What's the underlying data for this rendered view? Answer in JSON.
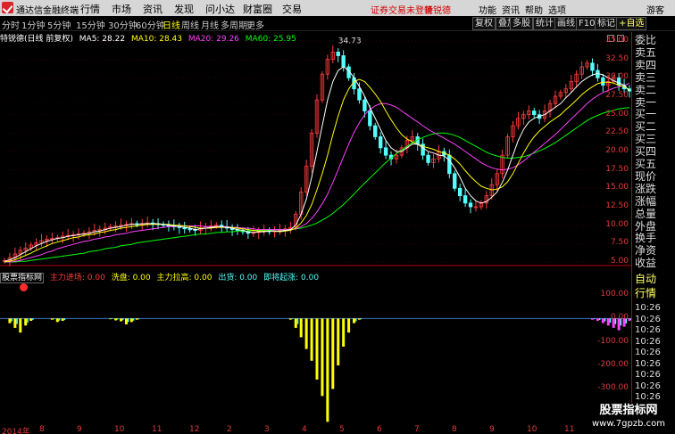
{
  "app_title": "通达信金融终端",
  "menu": [
    "行情",
    "市场",
    "资讯",
    "发现",
    "问小达",
    "财富圈",
    "交易"
  ],
  "status_warning": "证券交易未登录",
  "status_stock": "特锐德",
  "right_menu": [
    "功能",
    "资讯",
    "帮助",
    "选项",
    "游客"
  ],
  "periods": [
    {
      "label": "分时",
      "active": false
    },
    {
      "label": "1分钟",
      "active": false
    },
    {
      "label": "5分钟",
      "active": false
    },
    {
      "label": "15分钟",
      "active": false
    },
    {
      "label": "30分钟",
      "active": false
    },
    {
      "label": "60分钟",
      "active": false
    },
    {
      "label": "日线",
      "active": true
    },
    {
      "label": "周线",
      "active": false
    },
    {
      "label": "月线",
      "active": false
    },
    {
      "label": "多周期",
      "active": false
    },
    {
      "label": "更多",
      "active": false
    }
  ],
  "toolbar": [
    "复权",
    "叠加",
    "多股",
    "统计",
    "画线",
    "F10",
    "标记",
    "+自选"
  ],
  "legend": {
    "title": "特锐德(日线 前复权)",
    "ma5": "MA5: 28.22",
    "ma10": "MA10: 28.43",
    "ma20": "MA20: 29.26",
    "ma60": "MA60: 25.95"
  },
  "colors": {
    "ma5": "#ffffff",
    "ma10": "#ffff00",
    "ma20": "#ff40ff",
    "ma60": "#00ff00",
    "up": "#ff3c3c",
    "down": "#54ffff",
    "axis": "#dd3b3b",
    "warn": "#d40000"
  },
  "peak_label": "34.73",
  "indicator": {
    "name": "股票指标网",
    "main_entry": "主力进场: 0.00",
    "wash": "洗盘: 0.00",
    "pullup": "主力拉高: 0.00",
    "exit": "出货: 0.00",
    "surge": "即将起涨: 0.00"
  },
  "price_axis": [
    "35.00",
    "32.50",
    "30.00",
    "27.50",
    "25.00",
    "22.50",
    "20.00",
    "17.50",
    "15.00",
    "12.50",
    "10.00",
    "7.50",
    "5.00"
  ],
  "ind_axis": [
    "100.00",
    "0.00",
    "-100.00",
    "-200.00",
    "-300.00",
    "-400.00"
  ],
  "x_axis": [
    "2014年",
    "8",
    "9",
    "10",
    "11",
    "12",
    "2",
    "3",
    "4",
    "5",
    "6",
    "7",
    "8",
    "9",
    "10",
    "11"
  ],
  "side": {
    "items": [
      "委比",
      "卖五",
      "卖四",
      "卖三",
      "卖二",
      "卖一",
      "买一",
      "买二",
      "买三",
      "买四",
      "买五",
      "现价",
      "涨跌",
      "涨幅",
      "总量",
      "外盘",
      "换手",
      "净资",
      "收益"
    ],
    "auto": "自动",
    "quote": "行情",
    "times": [
      "10:26",
      "10:26",
      "10:26",
      "10:26",
      "10:26",
      "10:26",
      "10:26",
      "10:26",
      "10:26",
      "10:26",
      "10:26",
      "10:26"
    ],
    "unit": "500"
  },
  "watermark": {
    "line1": "股票指标网",
    "line2": "www.7gpzb.com"
  },
  "chart_data": {
    "type": "candlestick",
    "ylim": [
      5,
      35
    ],
    "ind_ylim": [
      -450,
      100
    ],
    "close": [
      5.2,
      5.6,
      6.1,
      6.6,
      6.9,
      7.3,
      7.6,
      7.9,
      8.1,
      8.2,
      8.3,
      8.5,
      8.6,
      8.7,
      8.8,
      8.9,
      9.1,
      9.3,
      9.4,
      9.6,
      9.8,
      9.9,
      10.0,
      10.1,
      10.2,
      10.1,
      10.2,
      10.3,
      10.2,
      10.1,
      10.0,
      9.9,
      9.8,
      9.7,
      9.5,
      9.4,
      9.3,
      9.6,
      9.8,
      9.9,
      10.0,
      9.8,
      9.6,
      9.4,
      9.3,
      9.1,
      8.9,
      9.0,
      9.2,
      9.3,
      9.1,
      9.2,
      9.3,
      9.5,
      9.7,
      11.5,
      14.5,
      18.0,
      22.5,
      27.0,
      30.5,
      32.5,
      33.5,
      33.0,
      31.5,
      30.0,
      28.5,
      27.0,
      25.5,
      23.5,
      22.0,
      20.5,
      19.5,
      19.0,
      19.5,
      20.5,
      21.5,
      22.0,
      21.0,
      19.5,
      18.5,
      19.0,
      20.0,
      19.5,
      17.0,
      15.0,
      14.0,
      13.0,
      12.5,
      12.5,
      13.0,
      14.0,
      15.5,
      17.0,
      19.5,
      22.0,
      23.5,
      24.5,
      25.0,
      25.5,
      25.0,
      24.5,
      25.5,
      26.5,
      27.5,
      28.0,
      28.5,
      29.5,
      30.5,
      31.5,
      32.0,
      31.0,
      30.0,
      29.0,
      29.5,
      30.0,
      29.0,
      28.5,
      28.2
    ],
    "ma5": [
      5.1,
      5.3,
      5.6,
      6.0,
      6.4,
      6.8,
      7.2,
      7.5,
      7.8,
      8.0,
      8.2,
      8.3,
      8.5,
      8.6,
      8.7,
      8.8,
      8.9,
      9.1,
      9.2,
      9.4,
      9.6,
      9.7,
      9.8,
      10.0,
      10.1,
      10.1,
      10.2,
      10.2,
      10.2,
      10.2,
      10.1,
      10.0,
      9.9,
      9.8,
      9.7,
      9.6,
      9.4,
      9.5,
      9.6,
      9.7,
      9.8,
      9.8,
      9.7,
      9.6,
      9.4,
      9.3,
      9.1,
      9.0,
      9.1,
      9.1,
      9.2,
      9.2,
      9.2,
      9.3,
      9.4,
      10.0,
      11.5,
      13.5,
      16.5,
      20.0,
      23.5,
      27.0,
      29.5,
      31.0,
      31.5,
      31.0,
      30.0,
      28.8,
      27.5,
      26.0,
      24.5,
      23.0,
      21.5,
      20.5,
      20.0,
      20.0,
      20.5,
      21.0,
      21.0,
      20.5,
      20.0,
      19.8,
      19.5,
      19.4,
      18.8,
      17.8,
      16.5,
      15.0,
      14.0,
      13.3,
      13.0,
      13.2,
      13.8,
      14.5,
      15.8,
      17.5,
      19.5,
      21.5,
      23.0,
      24.0,
      24.5,
      24.8,
      25.0,
      25.5,
      26.0,
      26.5,
      27.3,
      28.0,
      28.8,
      29.5,
      30.0,
      30.4,
      30.6,
      30.4,
      30.0,
      29.6,
      29.3,
      29.0,
      28.2
    ],
    "ma10": [
      5.0,
      5.1,
      5.3,
      5.6,
      5.9,
      6.2,
      6.6,
      6.9,
      7.2,
      7.5,
      7.7,
      7.9,
      8.1,
      8.3,
      8.4,
      8.6,
      8.7,
      8.8,
      9.0,
      9.1,
      9.3,
      9.4,
      9.6,
      9.7,
      9.8,
      9.9,
      10.0,
      10.1,
      10.1,
      10.1,
      10.1,
      10.1,
      10.0,
      10.0,
      9.9,
      9.8,
      9.7,
      9.6,
      9.6,
      9.6,
      9.7,
      9.7,
      9.7,
      9.7,
      9.6,
      9.5,
      9.4,
      9.3,
      9.2,
      9.2,
      9.2,
      9.2,
      9.1,
      9.2,
      9.3,
      9.6,
      10.3,
      11.3,
      12.8,
      14.8,
      17.0,
      19.5,
      22.3,
      24.8,
      27.0,
      28.5,
      29.5,
      29.8,
      29.5,
      28.7,
      27.8,
      26.8,
      25.5,
      24.3,
      23.2,
      22.3,
      21.7,
      21.3,
      21.0,
      20.7,
      20.5,
      20.3,
      20.0,
      19.8,
      19.5,
      19.0,
      18.3,
      17.4,
      16.6,
      15.9,
      15.3,
      15.0,
      14.8,
      14.9,
      15.2,
      15.9,
      17.0,
      18.4,
      19.8,
      21.0,
      22.0,
      22.8,
      23.4,
      24.0,
      24.5,
      25.0,
      25.7,
      26.3,
      27.0,
      27.7,
      28.3,
      28.8,
      29.2,
      29.4,
      29.4,
      29.3,
      29.0,
      28.8,
      28.4
    ],
    "ma20": [
      5.0,
      5.0,
      5.1,
      5.2,
      5.4,
      5.6,
      5.8,
      6.0,
      6.3,
      6.5,
      6.8,
      7.0,
      7.2,
      7.4,
      7.6,
      7.8,
      7.9,
      8.1,
      8.2,
      8.4,
      8.5,
      8.7,
      8.8,
      8.9,
      9.1,
      9.2,
      9.3,
      9.4,
      9.5,
      9.6,
      9.7,
      9.8,
      9.8,
      9.9,
      9.9,
      9.9,
      9.9,
      9.9,
      9.8,
      9.8,
      9.8,
      9.8,
      9.8,
      9.7,
      9.7,
      9.6,
      9.6,
      9.5,
      9.4,
      9.4,
      9.4,
      9.4,
      9.4,
      9.4,
      9.4,
      9.5,
      9.8,
      10.2,
      10.9,
      11.8,
      12.9,
      14.2,
      15.8,
      17.5,
      19.3,
      21.0,
      22.6,
      23.9,
      25.0,
      25.7,
      26.2,
      26.5,
      26.5,
      26.3,
      26.0,
      25.5,
      25.0,
      24.5,
      24.0,
      23.5,
      23.0,
      22.6,
      22.2,
      21.8,
      21.4,
      21.0,
      20.5,
      20.0,
      19.5,
      19.0,
      18.5,
      18.1,
      17.8,
      17.6,
      17.5,
      17.6,
      17.8,
      18.2,
      18.7,
      19.3,
      19.9,
      20.5,
      21.1,
      21.7,
      22.3,
      23.0,
      23.7,
      24.4,
      25.1,
      25.8,
      26.5,
      27.1,
      27.6,
      28.0,
      28.3,
      28.6,
      28.8,
      29.0,
      29.26
    ],
    "ma60": [
      5.0,
      5.0,
      5.0,
      5.1,
      5.1,
      5.2,
      5.3,
      5.4,
      5.5,
      5.6,
      5.7,
      5.8,
      5.9,
      6.0,
      6.1,
      6.2,
      6.4,
      6.5,
      6.6,
      6.8,
      6.9,
      7.0,
      7.2,
      7.3,
      7.4,
      7.6,
      7.7,
      7.8,
      7.9,
      8.0,
      8.1,
      8.2,
      8.3,
      8.4,
      8.5,
      8.6,
      8.7,
      8.8,
      8.8,
      8.9,
      9.0,
      9.0,
      9.1,
      9.1,
      9.2,
      9.2,
      9.2,
      9.3,
      9.3,
      9.3,
      9.3,
      9.4,
      9.4,
      9.4,
      9.4,
      9.5,
      9.6,
      9.8,
      10.0,
      10.3,
      10.7,
      11.1,
      11.6,
      12.2,
      12.8,
      13.5,
      14.2,
      15.0,
      15.7,
      16.4,
      17.1,
      17.8,
      18.5,
      19.1,
      19.7,
      20.2,
      20.7,
      21.2,
      21.6,
      21.9,
      22.2,
      22.4,
      22.5,
      22.5,
      22.4,
      22.2,
      21.9,
      21.5,
      21.1,
      20.7,
      20.3,
      19.9,
      19.6,
      19.4,
      19.2,
      19.1,
      19.1,
      19.2,
      19.3,
      19.5,
      19.8,
      20.1,
      20.4,
      20.8,
      21.2,
      21.7,
      22.2,
      22.7,
      23.2,
      23.7,
      24.2,
      24.6,
      24.9,
      25.2,
      25.4,
      25.6,
      25.8,
      25.9,
      25.95
    ],
    "ind_neg": [
      0,
      -20,
      -40,
      -60,
      -30,
      -10,
      0,
      0,
      0,
      -5,
      -15,
      -10,
      0,
      0,
      0,
      0,
      0,
      0,
      0,
      0,
      -3,
      -8,
      -12,
      -25,
      -15,
      -5,
      0,
      0,
      0,
      0,
      0,
      0,
      0,
      0,
      0,
      0,
      0,
      0,
      0,
      0,
      0,
      0,
      0,
      0,
      0,
      0,
      0,
      0,
      0,
      0,
      0,
      0,
      0,
      0,
      -5,
      -40,
      -80,
      -130,
      -180,
      -260,
      -330,
      -440,
      -300,
      -200,
      -120,
      -60,
      -20,
      -5,
      0,
      0,
      0,
      0,
      0,
      0,
      0,
      0,
      0,
      0,
      0,
      0,
      0,
      0,
      0,
      0,
      0,
      0,
      0,
      0,
      0,
      0,
      0,
      0,
      0,
      0,
      0,
      0,
      0,
      0,
      0,
      0,
      0,
      0,
      0,
      0,
      0,
      0,
      0,
      0,
      0,
      0,
      0,
      -5,
      -10,
      -20,
      -30,
      -40,
      -50,
      -35,
      -10,
      0
    ]
  }
}
